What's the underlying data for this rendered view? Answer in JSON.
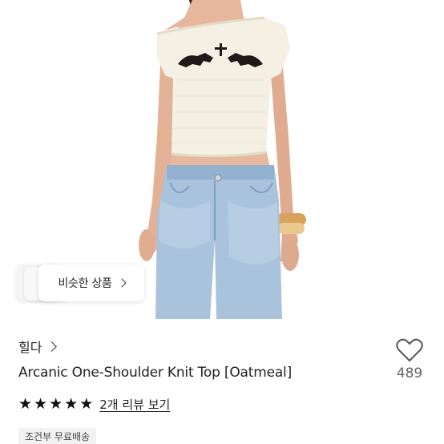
{
  "product": {
    "image_alt": "Model wearing oatmeal one-shoulder knit top with horse graphic and light wash jeans",
    "shop_name": "힐다",
    "title": "Arcanic One-Shoulder Knit Top [Oatmeal]",
    "wish_count": "489",
    "rating": 5,
    "review_label": "2개 리뷰 보기",
    "shipping_badge": "조건부 무료배송"
  },
  "similar": {
    "label": "비슷한 상품"
  },
  "colors": {
    "text_primary": "#222222",
    "text_secondary": "#666666",
    "badge_bg": "#f2f2f2",
    "star": "#111111"
  },
  "icons": {
    "wish": "heart-outline-icon",
    "star": "star-filled-icon",
    "chevron": "chevron-right-icon"
  }
}
